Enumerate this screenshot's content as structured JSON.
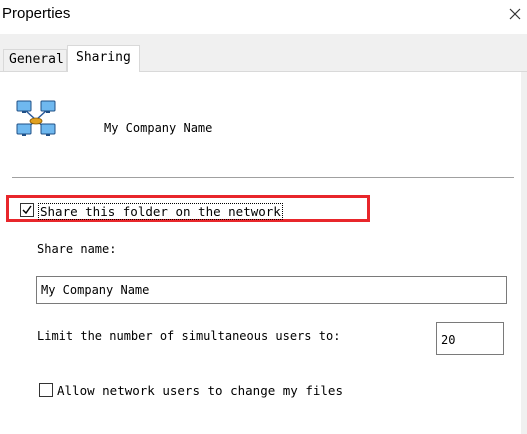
{
  "window": {
    "title": "Properties"
  },
  "tabs": [
    {
      "label": "General",
      "active": false
    },
    {
      "label": "Sharing",
      "active": true
    }
  ],
  "sharing": {
    "folder_name": "My Company Name",
    "share_checkbox": {
      "label": "Share this folder on the network",
      "checked": true
    },
    "share_name_label": "Share name:",
    "share_name_value": "My Company Name",
    "limit_label": "Limit the number of simultaneous users to:",
    "limit_value": "20",
    "allow_checkbox": {
      "label": "Allow network users to change my files",
      "checked": false
    }
  },
  "icons": {
    "close": "close-icon",
    "network": "network-share-icon",
    "check": "checkmark-icon"
  },
  "colors": {
    "highlight": "#e8262b",
    "tab_bg": "#f0f0f0"
  }
}
